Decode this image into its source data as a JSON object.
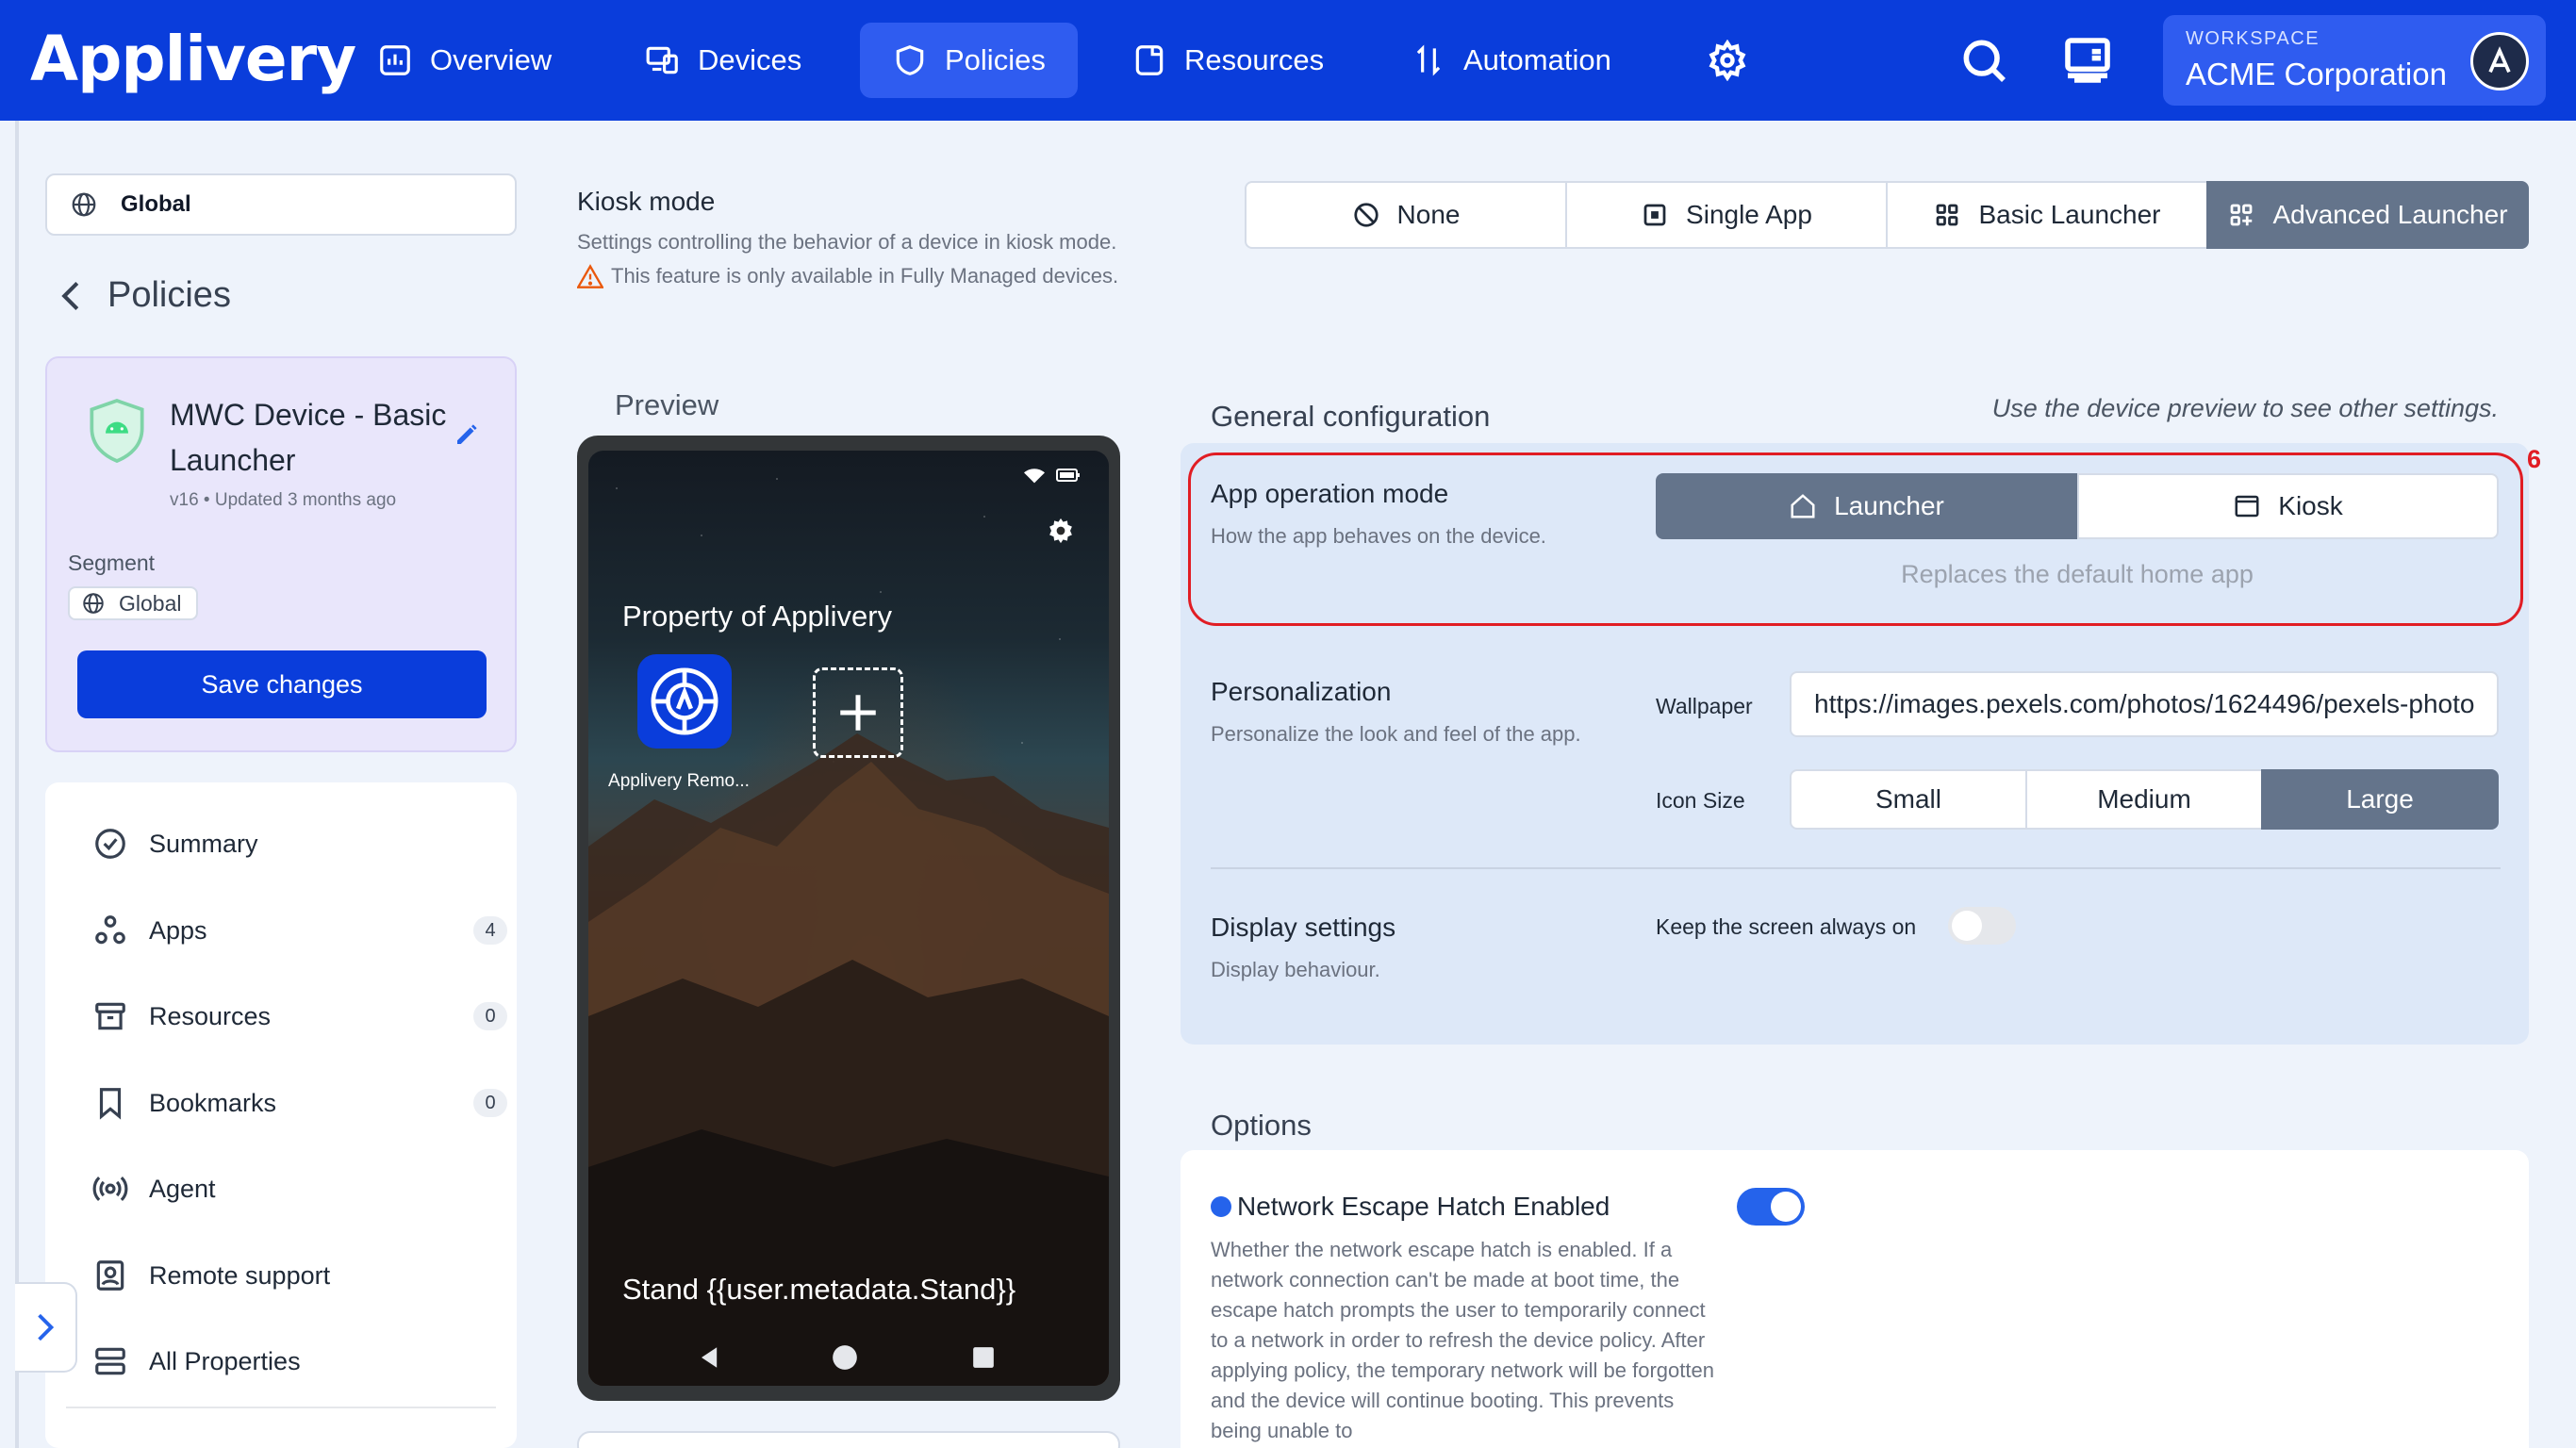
{
  "app": {
    "logo": "Applivery"
  },
  "nav": {
    "items": [
      {
        "label": "Overview",
        "icon": "chart-icon"
      },
      {
        "label": "Devices",
        "icon": "devices-icon"
      },
      {
        "label": "Policies",
        "icon": "shield-icon",
        "active": true
      },
      {
        "label": "Resources",
        "icon": "folder-icon"
      },
      {
        "label": "Automation",
        "icon": "automation-icon"
      }
    ],
    "workspace_label": "WORKSPACE",
    "workspace_name": "ACME Corporation"
  },
  "sidebar": {
    "segment_select": "Global",
    "back_label": "Policies",
    "policy": {
      "name": "MWC Device - Basic Launcher",
      "meta": "v16 • Updated 3 months ago",
      "segment_label": "Segment",
      "segment_value": "Global"
    },
    "save_label": "Save changes",
    "menu": [
      {
        "label": "Summary",
        "count": null
      },
      {
        "label": "Apps",
        "count": "4"
      },
      {
        "label": "Resources",
        "count": "0"
      },
      {
        "label": "Bookmarks",
        "count": "0"
      },
      {
        "label": "Agent",
        "count": null
      },
      {
        "label": "Remote support",
        "count": null
      },
      {
        "label": "All Properties",
        "count": null
      }
    ]
  },
  "kiosk": {
    "title": "Kiosk mode",
    "description": "Settings controlling the behavior of a device in kiosk mode.",
    "warning": "This feature is only available in Fully Managed devices.",
    "modes": [
      "None",
      "Single App",
      "Basic Launcher",
      "Advanced Launcher"
    ],
    "selected_mode": "Advanced Launcher"
  },
  "preview": {
    "label": "Preview",
    "property_title": "Property of Applivery",
    "app_label": "Applivery Remo...",
    "stand_text": "Stand {{user.metadata.Stand}}"
  },
  "general": {
    "title": "General configuration",
    "hint": "Use the device preview to see other settings.",
    "annotation_number": "6",
    "app_operation": {
      "title": "App operation mode",
      "desc": "How the app behaves on the device.",
      "options": [
        "Launcher",
        "Kiosk"
      ],
      "selected": "Launcher",
      "hint": "Replaces the default home app"
    },
    "personalization": {
      "title": "Personalization",
      "desc": "Personalize the look and feel of the app.",
      "wallpaper_label": "Wallpaper",
      "wallpaper_value": "https://images.pexels.com/photos/1624496/pexels-photo",
      "icon_size_label": "Icon Size",
      "icon_sizes": [
        "Small",
        "Medium",
        "Large"
      ],
      "selected_size": "Large"
    },
    "display": {
      "title": "Display settings",
      "desc": "Display behaviour.",
      "screen_on_label": "Keep the screen always on",
      "screen_on": false
    }
  },
  "options": {
    "title": "Options",
    "escape_hatch": {
      "name": "Network Escape Hatch Enabled",
      "enabled": true,
      "desc": "Whether the network escape hatch is enabled. If a network connection can't be made at boot time, the escape hatch prompts the user to temporarily connect to a network in order to refresh the device policy. After applying policy, the temporary network will be forgotten and the device will continue booting. This prevents being unable to"
    }
  },
  "colors": {
    "brand": "#0a3ddb",
    "selected": "#64748b",
    "highlight": "#e11d24"
  }
}
